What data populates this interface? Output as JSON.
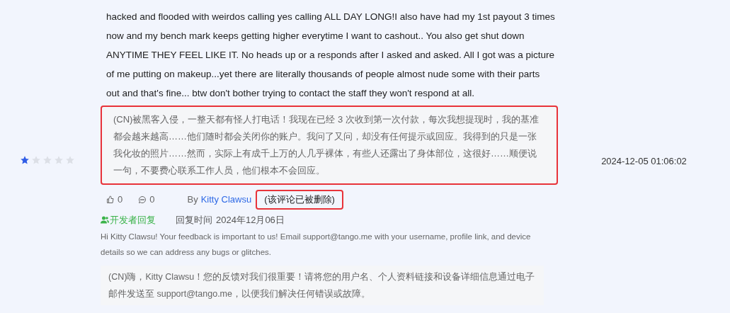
{
  "review": {
    "text": "hacked and flooded with weirdos calling yes calling ALL DAY LONG!I also have had my 1st payout 3 times now and my bench mark keeps getting higher everytime I want to cashout.. You also get shut down ANYTIME THEY FEEL LIKE IT. No heads up or a responds after I asked and asked. All I got was a picture of me putting on makeup...yet there are literally thousands of people almost nude some with their parts out and that's fine... btw don't bother trying to contact the staff they won't respond at all.",
    "translation": {
      "text": "(CN)被黑客入侵，一整天都有怪人打电话！我现在已经 3 次收到第一次付款，每次我想提现时，我的基准都会越来越高……他们随时都会关闭你的账户。我问了又问，却没有任何提示或回应。我得到的只是一张我化妆的照片……然而，实际上有成千上万的人几乎裸体，有些人还露出了身体部位，这很好……顺便说一句，不要费心联系工作人员，他们根本不会回应。",
      "highlighted": true
    },
    "stars": 1,
    "date": "2024-12-05 01:06:02",
    "likes": "0",
    "comments": "0",
    "by": "By",
    "author": "Kitty Clawsu",
    "deleted_note": {
      "text": "(该评论已被删除)",
      "highlighted": true
    }
  },
  "reply": {
    "label": "开发者回复",
    "time_label": "回复时间",
    "time": "2024年12月06日",
    "text": "Hi Kitty Clawsu! Your feedback is important to us! Email support@tango.me with your username, profile link, and device details so we can address any bugs or glitches.",
    "translation": "(CN)嗨，Kitty Clawsu！您的反馈对我们很重要！请将您的用户名、个人资料链接和设备详细信息通过电子邮件发送至 support@tango.me，以便我们解决任何错误或故障。"
  }
}
